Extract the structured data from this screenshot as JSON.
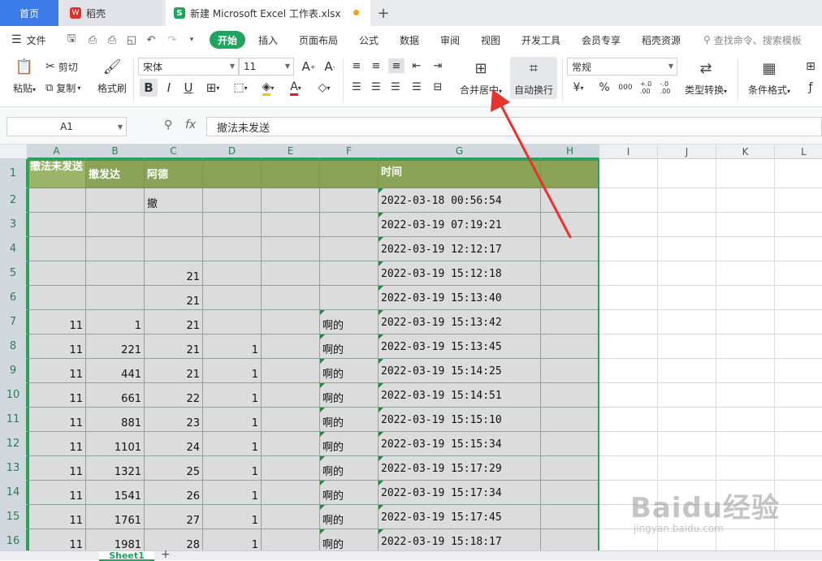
{
  "titlebar": {
    "tab_home": "首页",
    "tab_daoke": "稻壳",
    "tab_file": "新建 Microsoft Excel 工作表.xlsx",
    "tab_add": "+",
    "logo_w": "W",
    "logo_s": "S"
  },
  "menubar": {
    "file": "文件",
    "items": [
      "开始",
      "插入",
      "页面布局",
      "公式",
      "数据",
      "审阅",
      "视图",
      "开发工具",
      "会员专享",
      "稻壳资源"
    ],
    "search": "查找命令、搜索模板"
  },
  "ribbon": {
    "paste": "粘贴",
    "cut": "剪切",
    "copy": "复制",
    "format_painter": "格式刷",
    "font_name": "宋体",
    "font_size": "11",
    "font_grow": "A",
    "font_shrink": "A",
    "bold": "B",
    "italic": "I",
    "underline": "U",
    "merge_center": "合并居中",
    "auto_wrap": "自动换行",
    "number_format": "常规",
    "currency": "¥",
    "percent": "%",
    "thousands": "000",
    "inc_decimal": "+.0\n.00",
    "dec_decimal": "-.0\n.00",
    "type_convert": "类型转换",
    "cond_format": "条件格式"
  },
  "formula_bar": {
    "name_box": "A1",
    "fx": "fx",
    "content": "撤法未发送"
  },
  "columns": [
    "A",
    "B",
    "C",
    "D",
    "E",
    "F",
    "G",
    "H",
    "I",
    "J",
    "K",
    "L"
  ],
  "rows": [
    "1",
    "2",
    "3",
    "4",
    "5",
    "6",
    "7",
    "8",
    "9",
    "10",
    "11",
    "12",
    "13",
    "14",
    "15",
    "16"
  ],
  "cells": {
    "header": {
      "A": "撤法未发送",
      "B": "撤发达",
      "C": "阿德",
      "G": "时间"
    },
    "data": [
      {
        "C": "撤",
        "G": "2022-03-18 00:56:54"
      },
      {
        "G": "2022-03-19 07:19:21"
      },
      {
        "G": "2022-03-19 12:12:17"
      },
      {
        "C": "21",
        "G": "2022-03-19 15:12:18"
      },
      {
        "C": "21",
        "G": "2022-03-19 15:13:40"
      },
      {
        "A": "11",
        "B": "1",
        "C": "21",
        "F": "啊的",
        "G": "2022-03-19 15:13:42"
      },
      {
        "A": "11",
        "B": "221",
        "C": "21",
        "D": "1",
        "F": "啊的",
        "G": "2022-03-19 15:13:45"
      },
      {
        "A": "11",
        "B": "441",
        "C": "21",
        "D": "1",
        "F": "啊的",
        "G": "2022-03-19 15:14:25"
      },
      {
        "A": "11",
        "B": "661",
        "C": "22",
        "D": "1",
        "F": "啊的",
        "G": "2022-03-19 15:14:51"
      },
      {
        "A": "11",
        "B": "881",
        "C": "23",
        "D": "1",
        "F": "啊的",
        "G": "2022-03-19 15:15:10"
      },
      {
        "A": "11",
        "B": "1101",
        "C": "24",
        "D": "1",
        "F": "啊的",
        "G": "2022-03-19 15:15:34"
      },
      {
        "A": "11",
        "B": "1321",
        "C": "25",
        "D": "1",
        "F": "啊的",
        "G": "2022-03-19 15:17:29"
      },
      {
        "A": "11",
        "B": "1541",
        "C": "26",
        "D": "1",
        "F": "啊的",
        "G": "2022-03-19 15:17:34"
      },
      {
        "A": "11",
        "B": "1761",
        "C": "27",
        "D": "1",
        "F": "啊的",
        "G": "2022-03-19 15:17:45"
      },
      {
        "A": "11",
        "B": "1981",
        "C": "28",
        "D": "1",
        "F": "啊的",
        "G": "2022-03-19 15:18:17"
      }
    ]
  },
  "sheets": {
    "active": "Sheet1",
    "add": "+"
  },
  "watermark": {
    "brand": "Baidu经验",
    "url": "jingyan.baidu.com"
  },
  "colors": {
    "accent": "#1fa462",
    "header_fill": "#8aa357",
    "range_fill": "#dcdcdc",
    "arrow": "#e8322c"
  }
}
